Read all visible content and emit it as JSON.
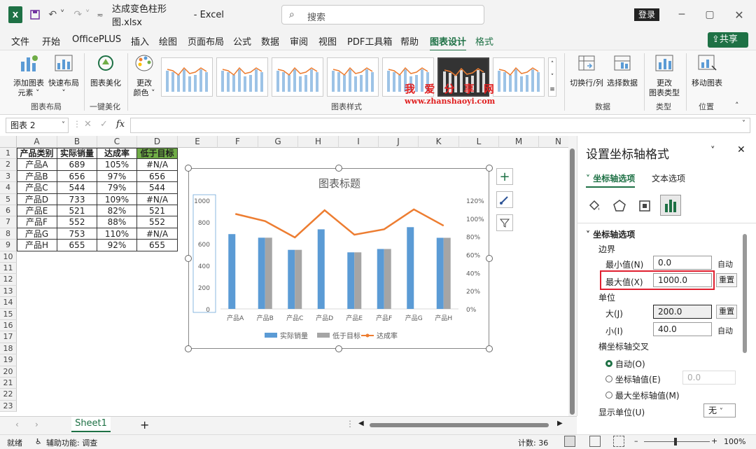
{
  "titlebar": {
    "filename": "达成变色柱形图.xlsx",
    "sep": "-",
    "app": "Excel",
    "search_placeholder": "搜索",
    "login": "登录"
  },
  "menu": [
    "文件",
    "开始",
    "OfficePLUS",
    "插入",
    "绘图",
    "页面布局",
    "公式",
    "数据",
    "审阅",
    "视图",
    "PDF工具箱",
    "帮助",
    "图表设计",
    "格式"
  ],
  "menu_active": "图表设计",
  "share": "共享",
  "ribbon": {
    "add_element": "添加图表",
    "add_element2": "元素",
    "quick_layout": "快速布局",
    "group_layout": "图表布局",
    "beautify": "图表美化",
    "group_beautify": "一键美化",
    "change_color": "更改",
    "change_color2": "颜色",
    "group_styles": "图表样式",
    "switch": "切换行/列",
    "select_data": "选择数据",
    "group_data": "数据",
    "change_type": "更改",
    "change_type2": "图表类型",
    "group_type": "类型",
    "move": "移动图表",
    "group_location": "位置"
  },
  "watermark": {
    "title": "我 爱 分 享 网",
    "url": "www.zhanshaoyi.com"
  },
  "formula": {
    "namebox": "图表 2",
    "fx": "fx"
  },
  "columns": [
    "A",
    "B",
    "C",
    "D",
    "E",
    "F",
    "G",
    "H",
    "I",
    "J",
    "K",
    "L",
    "M",
    "N"
  ],
  "rows": [
    "1",
    "2",
    "3",
    "4",
    "5",
    "6",
    "7",
    "8",
    "9",
    "10",
    "11",
    "12",
    "13",
    "14",
    "15",
    "16",
    "17",
    "18",
    "19",
    "20",
    "21",
    "22",
    "23"
  ],
  "table": {
    "headers": [
      "产品类别",
      "实际销量",
      "达成率",
      "低于目标"
    ],
    "rows": [
      [
        "产品A",
        "689",
        "105%",
        "#N/A"
      ],
      [
        "产品B",
        "656",
        "97%",
        "656"
      ],
      [
        "产品C",
        "544",
        "79%",
        "544"
      ],
      [
        "产品D",
        "733",
        "109%",
        "#N/A"
      ],
      [
        "产品E",
        "521",
        "82%",
        "521"
      ],
      [
        "产品F",
        "552",
        "88%",
        "552"
      ],
      [
        "产品G",
        "753",
        "110%",
        "#N/A"
      ],
      [
        "产品H",
        "655",
        "92%",
        "655"
      ]
    ]
  },
  "chart_data": {
    "type": "bar",
    "title": "图表标题",
    "categories": [
      "产品A",
      "产品B",
      "产品C",
      "产品D",
      "产品E",
      "产品F",
      "产品G",
      "产品H"
    ],
    "series": [
      {
        "name": "实际销量",
        "values": [
          689,
          656,
          544,
          733,
          521,
          552,
          753,
          655
        ],
        "color": "#5b9bd5",
        "axis": "left"
      },
      {
        "name": "低于目标",
        "values": [
          null,
          656,
          544,
          null,
          521,
          552,
          null,
          655
        ],
        "color": "#a5a5a5",
        "axis": "left"
      },
      {
        "name": "达成率",
        "values": [
          1.05,
          0.97,
          0.79,
          1.09,
          0.82,
          0.88,
          1.1,
          0.92
        ],
        "color": "#ed7d31",
        "axis": "right",
        "type": "line"
      }
    ],
    "ylim": [
      0,
      1000
    ],
    "yticks": [
      "0",
      "200",
      "400",
      "600",
      "800",
      "1000"
    ],
    "y2lim": [
      0,
      1.2
    ],
    "y2ticks": [
      "0%",
      "20%",
      "40%",
      "60%",
      "80%",
      "100%",
      "120%"
    ],
    "legend": "bottom",
    "grid": false
  },
  "pane": {
    "title": "设置坐标轴格式",
    "tab1": "坐标轴选项",
    "tab2": "文本选项",
    "section": "坐标轴选项",
    "bounds": "边界",
    "min_label": "最小值(N)",
    "min_value": "0.0",
    "min_btn": "自动",
    "max_label": "最大值(X)",
    "max_value": "1000.0",
    "max_btn": "重置",
    "units": "单位",
    "major_label": "大(J)",
    "major_value": "200.0",
    "major_btn": "重置",
    "minor_label": "小(I)",
    "minor_value": "40.0",
    "minor_btn": "自动",
    "cross": "横坐标轴交叉",
    "auto": "自动(O)",
    "axis_value": "坐标轴值(E)",
    "axis_value_val": "0.0",
    "max_axis": "最大坐标轴值(M)",
    "display_units": "显示单位(U)",
    "display_value": "无"
  },
  "sheet": {
    "tab": "Sheet1"
  },
  "status": {
    "ready": "就绪",
    "accessibility": "辅助功能: 调查",
    "count": "计数: 36",
    "zoom": "100%"
  }
}
